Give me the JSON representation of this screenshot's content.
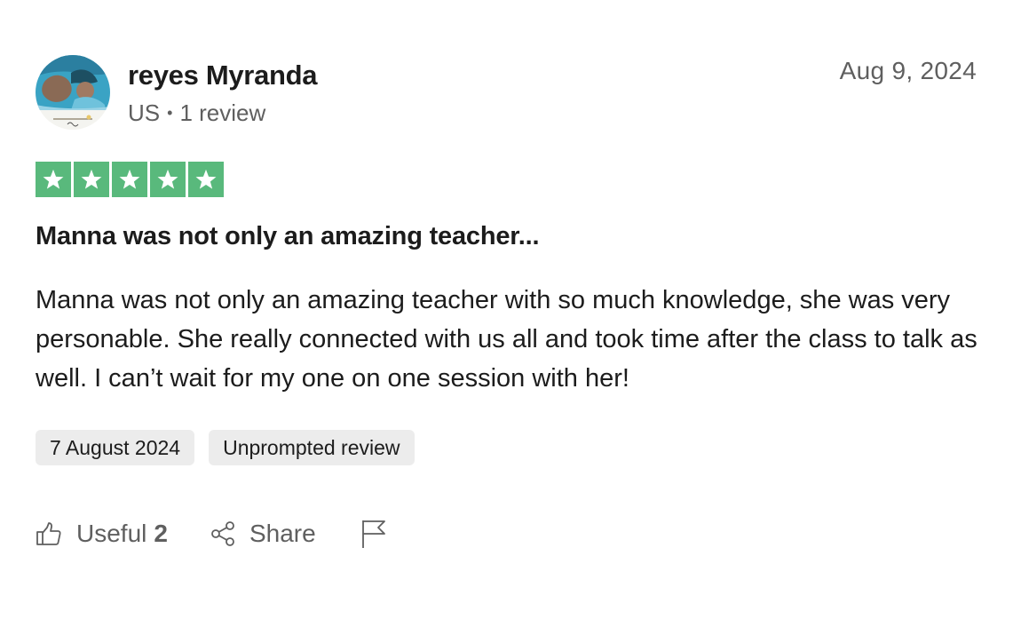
{
  "reviewer": {
    "name": "reyes Myranda",
    "country": "US",
    "separator": "•",
    "review_count": "1 review"
  },
  "review": {
    "posted_date": "Aug 9, 2024",
    "rating": 5,
    "title": "Manna was not only an amazing teacher...",
    "body": "Manna was not only an amazing teacher with so much knowledge, she was very personable. She really connected with us all and took time after the class to talk as well. I can’t wait for my one on one session with her!",
    "experience_date": "7 August 2024",
    "tag": "Unprompted review"
  },
  "actions": {
    "useful_label": "Useful",
    "useful_count": "2",
    "share_label": "Share"
  },
  "icons": {
    "thumbs_up": "thumbs-up-icon",
    "share": "share-icon",
    "flag": "flag-icon",
    "star": "star-icon"
  },
  "colors": {
    "star_green": "#59b97c",
    "badge_bg": "#ececec",
    "muted_text": "#5f5f5f",
    "main_text": "#1c1c1c"
  }
}
